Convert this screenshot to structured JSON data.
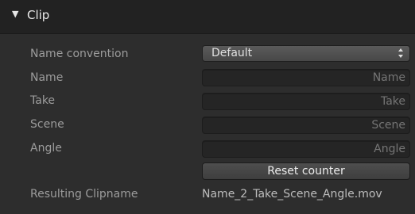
{
  "section": {
    "title": "Clip",
    "expanded_glyph": "▼"
  },
  "fields": {
    "name_convention": {
      "label": "Name convention",
      "value": "Default"
    },
    "name": {
      "label": "Name",
      "placeholder": "Name",
      "value": ""
    },
    "take": {
      "label": "Take",
      "placeholder": "Take",
      "value": ""
    },
    "scene": {
      "label": "Scene",
      "placeholder": "Scene",
      "value": ""
    },
    "angle": {
      "label": "Angle",
      "placeholder": "Angle",
      "value": ""
    }
  },
  "reset_button": {
    "label": "Reset counter"
  },
  "result": {
    "label": "Resulting Clipname",
    "value": "Name_2_Take_Scene_Angle.mov"
  },
  "icons": {
    "disclosure": "disclosure-triangle-icon",
    "dropdown": "up-down-arrows-icon"
  },
  "colors": {
    "panel_bg": "#2d2d2d",
    "header_bg": "#222222",
    "field_bg": "#252525",
    "label_text": "#9c9c9c"
  }
}
